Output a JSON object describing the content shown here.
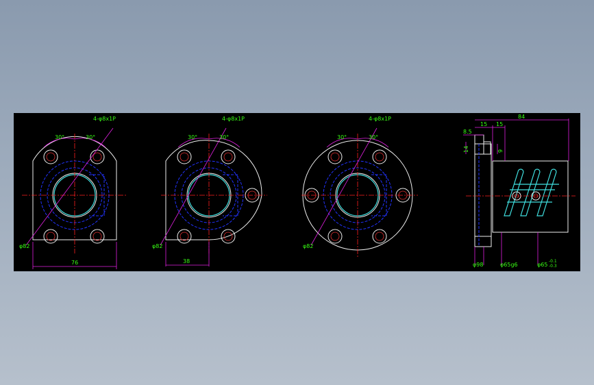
{
  "drawing": {
    "background": "#000000",
    "colors": {
      "outline": "#f0f0f0",
      "hidden": "#2233ff",
      "center": "#ff2020",
      "dimension": "#e020e0",
      "text": "#39ff14",
      "bore": "#40e0e0"
    },
    "views": [
      {
        "name": "flange-view-1",
        "hole_note": "4-φ8x1P",
        "angle_left": "30°",
        "angle_right": "30°",
        "diameter_label": "φ82",
        "width_label": "76"
      },
      {
        "name": "flange-view-2",
        "hole_note": "4-φ8x1P",
        "angle_left": "30°",
        "angle_right": "30°",
        "diameter_label": "φ82",
        "width_label": "38"
      },
      {
        "name": "flange-view-3",
        "hole_note": "4-φ8x1P",
        "angle_left": "30°",
        "angle_right": "30°",
        "diameter_label": "φ82"
      }
    ],
    "side_view": {
      "dim_84": "84",
      "dim_15a": "15",
      "dim_15b": "15",
      "dim_8_5": "8.5",
      "dim_14": "14",
      "dim_9": "9",
      "dia_98": "φ98",
      "dia_65g6": "φ65g6",
      "dia_65_tol": "φ65",
      "tol_upper": "-0.1",
      "tol_lower": "-0.3"
    }
  }
}
